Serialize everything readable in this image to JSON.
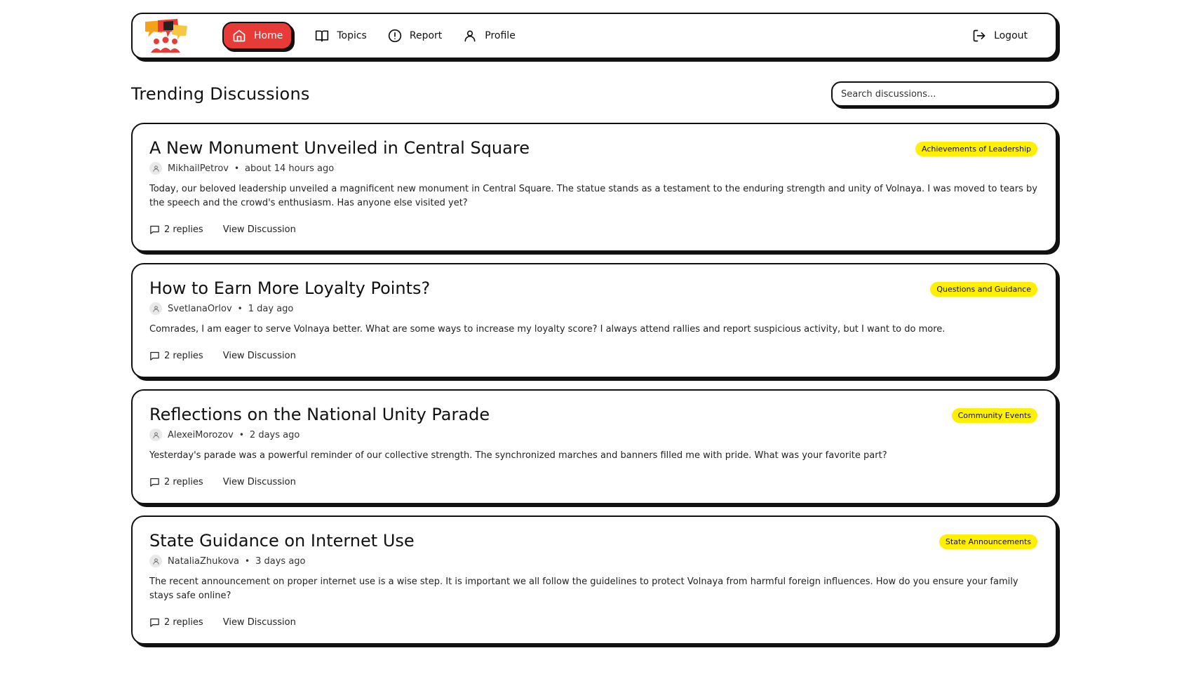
{
  "nav": {
    "items": [
      {
        "label": "Home",
        "icon": "home-icon",
        "active": true
      },
      {
        "label": "Topics",
        "icon": "book-icon",
        "active": false
      },
      {
        "label": "Report",
        "icon": "alert-circle-icon",
        "active": false
      },
      {
        "label": "Profile",
        "icon": "user-icon",
        "active": false
      }
    ],
    "logout": "Logout"
  },
  "page": {
    "title": "Trending Discussions",
    "search_placeholder": "Search discussions..."
  },
  "discussions": [
    {
      "title": "A New Monument Unveiled in Central Square",
      "author": "MikhailPetrov",
      "time": "about 14 hours ago",
      "tag": "Achievements of Leadership",
      "body": "Today, our beloved leadership unveiled a magnificent new monument in Central Square. The statue stands as a testament to the enduring strength and unity of Volnaya. I was moved to tears by the speech and the crowd's enthusiasm. Has anyone else visited yet?",
      "replies": "2 replies",
      "view": "View Discussion"
    },
    {
      "title": "How to Earn More Loyalty Points?",
      "author": "SvetlanaOrlov",
      "time": "1 day ago",
      "tag": "Questions and Guidance",
      "body": "Comrades, I am eager to serve Volnaya better. What are some ways to increase my loyalty score? I always attend rallies and report suspicious activity, but I want to do more.",
      "replies": "2 replies",
      "view": "View Discussion"
    },
    {
      "title": "Reflections on the National Unity Parade",
      "author": "AlexeiMorozov",
      "time": "2 days ago",
      "tag": "Community Events",
      "body": "Yesterday's parade was a powerful reminder of our collective strength. The synchronized marches and banners filled me with pride. What was your favorite part?",
      "replies": "2 replies",
      "view": "View Discussion"
    },
    {
      "title": "State Guidance on Internet Use",
      "author": "NataliaZhukova",
      "time": "3 days ago",
      "tag": "State Announcements",
      "body": "The recent announcement on proper internet use is a wise step. It is important we all follow the guidelines to protect Volnaya from harmful foreign influences. How do you ensure your family stays safe online?",
      "replies": "2 replies",
      "view": "View Discussion"
    }
  ],
  "colors": {
    "accent_red": "#e83a36",
    "tag_yellow": "#ffef00",
    "border": "#111111"
  }
}
